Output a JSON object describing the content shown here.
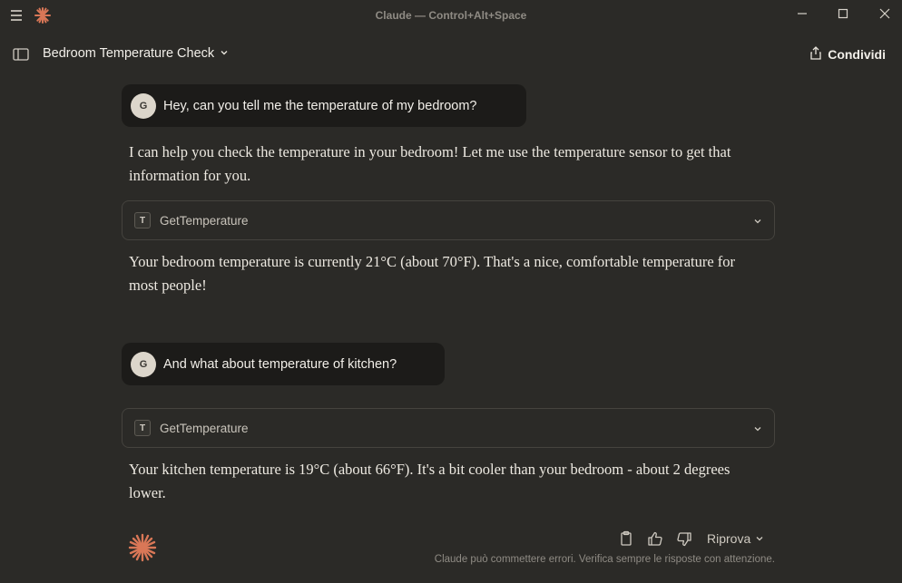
{
  "window": {
    "title": "Claude — Control+Alt+Space"
  },
  "header": {
    "conversation_title": "Bedroom Temperature Check",
    "share_label": "Condividi"
  },
  "messages": [
    {
      "role": "user",
      "avatar": "G",
      "text": "Hey, can you tell me the temperature of my bedroom?"
    },
    {
      "role": "assistant",
      "text": "I can help you check the temperature in your bedroom! Let me use the temperature sensor to get that information for you."
    },
    {
      "role": "tool",
      "badge": "T",
      "name": "GetTemperature"
    },
    {
      "role": "assistant",
      "text": "Your bedroom temperature is currently 21°C (about 70°F). That's a nice, comfortable temperature for most people!"
    },
    {
      "role": "user",
      "avatar": "G",
      "text": "And what about temperature of kitchen?"
    },
    {
      "role": "tool",
      "badge": "T",
      "name": "GetTemperature"
    },
    {
      "role": "assistant",
      "text": "Your kitchen temperature is 19°C (about 66°F). It's a bit cooler than your bedroom - about 2 degrees lower."
    }
  ],
  "footer": {
    "retry_label": "Riprova",
    "disclaimer": "Claude può commettere errori. Verifica sempre le risposte con attenzione."
  },
  "colors": {
    "background": "#2b2a27",
    "user_bubble": "#1c1b19",
    "accent": "#d97757"
  },
  "icons": {
    "menu": "hamburger-icon",
    "logo": "claude-asterisk-icon",
    "minimize": "minimize-icon",
    "maximize": "maximize-icon",
    "close": "close-icon",
    "sidebar": "sidebar-toggle-icon",
    "share": "share-icon",
    "copy": "clipboard-icon",
    "thumbs_up": "thumbs-up-icon",
    "thumbs_down": "thumbs-down-icon"
  }
}
